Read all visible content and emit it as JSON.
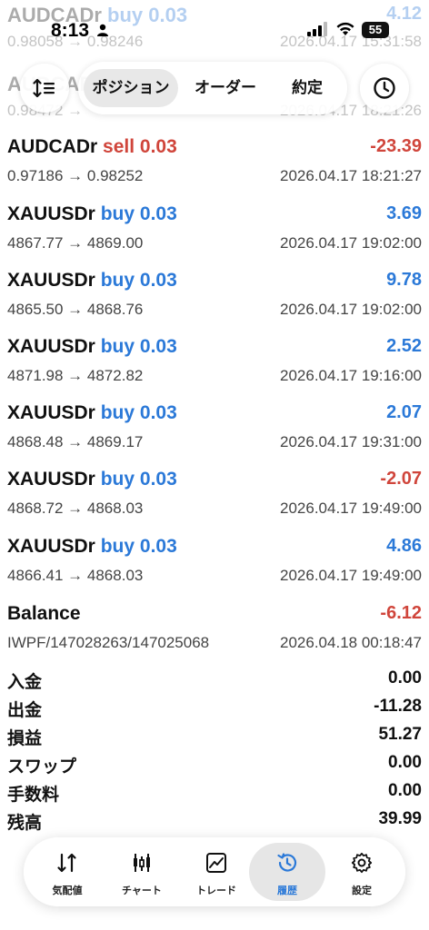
{
  "status_bar": {
    "time": "8:13",
    "battery": "55"
  },
  "background_rows": [
    {
      "symbol": "AUDCADr",
      "side": "buy",
      "volume": "0.03",
      "profit": "4.12",
      "prices": "0.98058 → 0.98246",
      "date": "2026.04.17 15:31:58"
    },
    {
      "symbol": "AUDCADr",
      "side": "",
      "volume": "",
      "profit": "",
      "prices": "0.98472 → ",
      "date": "2026.04.17 18:21:26"
    }
  ],
  "tabs": [
    {
      "label": "ポジション"
    },
    {
      "label": "オーダー"
    },
    {
      "label": "約定"
    }
  ],
  "icons": {
    "sort": "sort-icon",
    "history_period": "clock-icon"
  },
  "deals": [
    {
      "symbol": "AUDCADr",
      "side": "sell",
      "volume": "0.03",
      "prices": "0.97186 → 0.98252",
      "profit": "-23.39",
      "date": "2026.04.17 18:21:27"
    },
    {
      "symbol": "XAUUSDr",
      "side": "buy",
      "volume": "0.03",
      "prices": "4867.77 → 4869.00",
      "profit": "3.69",
      "date": "2026.04.17 19:02:00"
    },
    {
      "symbol": "XAUUSDr",
      "side": "buy",
      "volume": "0.03",
      "prices": "4865.50 → 4868.76",
      "profit": "9.78",
      "date": "2026.04.17 19:02:00"
    },
    {
      "symbol": "XAUUSDr",
      "side": "buy",
      "volume": "0.03",
      "prices": "4871.98 → 4872.82",
      "profit": "2.52",
      "date": "2026.04.17 19:16:00"
    },
    {
      "symbol": "XAUUSDr",
      "side": "buy",
      "volume": "0.03",
      "prices": "4868.48 → 4869.17",
      "profit": "2.07",
      "date": "2026.04.17 19:31:00"
    },
    {
      "symbol": "XAUUSDr",
      "side": "buy",
      "volume": "0.03",
      "prices": "4868.72 → 4868.03",
      "profit": "-2.07",
      "date": "2026.04.17 19:49:00"
    },
    {
      "symbol": "XAUUSDr",
      "side": "buy",
      "volume": "0.03",
      "prices": "4866.41 → 4868.03",
      "profit": "4.86",
      "date": "2026.04.17 19:49:00"
    },
    {
      "symbol": "Balance",
      "side": "",
      "volume": "",
      "prices": "IWPF/147028263/147025068",
      "profit": "-6.12",
      "date": "2026.04.18 00:18:47"
    }
  ],
  "summary": [
    {
      "label": "入金",
      "value": "0.00"
    },
    {
      "label": "出金",
      "value": "-11.28"
    },
    {
      "label": "損益",
      "value": "51.27"
    },
    {
      "label": "スワップ",
      "value": "0.00"
    },
    {
      "label": "手数料",
      "value": "0.00"
    },
    {
      "label": "残高",
      "value": "39.99"
    }
  ],
  "bottom_nav": [
    {
      "label": "気配値",
      "icon": "quotes-icon"
    },
    {
      "label": "チャート",
      "icon": "chart-icon"
    },
    {
      "label": "トレード",
      "icon": "trade-icon"
    },
    {
      "label": "履歴",
      "icon": "history-icon",
      "active": true
    },
    {
      "label": "設定",
      "icon": "settings-icon"
    }
  ],
  "colors": {
    "positive": "#2b79d8",
    "negative": "#d0453b",
    "active_tab": "#2b79d8"
  }
}
